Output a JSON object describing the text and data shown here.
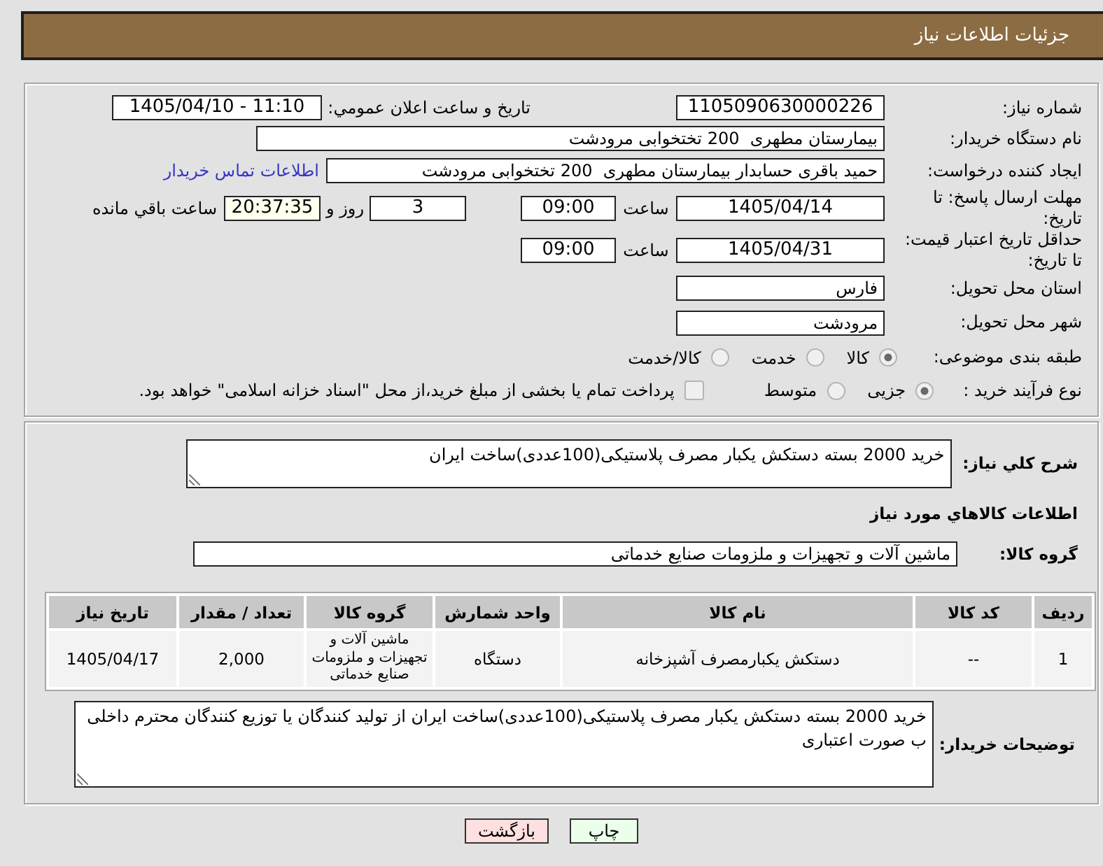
{
  "header": {
    "title": "جزئیات اطلاعات نیاز"
  },
  "need": {
    "need_number": {
      "label": "شماره نیاز:",
      "value": "1105090630000226"
    },
    "announcement": {
      "label": "تاريخ و ساعت اعلان عمومي:",
      "value": "1405/04/10 - 11:10"
    },
    "buyer_org": {
      "label": "نام دستگاه خریدار:",
      "value": "بیمارستان مطهری  200 تختخوابی مرودشت"
    },
    "requester": {
      "label": "ایجاد کننده درخواست:",
      "value": "حمید باقری حسابدار بیمارستان مطهری  200 تختخوابی مرودشت",
      "link": "اطلاعات تماس خریدار"
    },
    "response_deadline": {
      "label": "مهلت ارسال پاسخ: تا تاریخ:",
      "date": "1405/04/14",
      "time_label": "ساعت",
      "time": "09:00",
      "days": "3",
      "days_label": "روز و",
      "remaining": "20:37:35",
      "remaining_label": "ساعت باقي مانده"
    },
    "price_validity": {
      "label": "حداقل تاریخ اعتبار قیمت: تا تاریخ:",
      "date": "1405/04/31",
      "time_label": "ساعت",
      "time": "09:00"
    },
    "province": {
      "label": "استان محل تحویل:",
      "value": "فارس"
    },
    "city": {
      "label": "شهر محل تحویل:",
      "value": "مرودشت"
    },
    "category": {
      "label": "طبقه بندی موضوعی:",
      "options": [
        {
          "label": "کالا",
          "selected": true
        },
        {
          "label": "خدمت",
          "selected": false
        },
        {
          "label": "کالا/خدمت",
          "selected": false
        }
      ]
    },
    "purchase_process": {
      "label": "نوع فرآیند خرید :",
      "options": [
        {
          "label": "جزیی",
          "selected": true
        },
        {
          "label": "متوسط",
          "selected": false
        }
      ],
      "treasury": {
        "label": "پرداخت تمام یا بخشی از مبلغ خرید،از محل \"اسناد خزانه اسلامی\" خواهد بود.",
        "checked": false
      }
    }
  },
  "goods": {
    "description": {
      "label": "شرح کلي نياز:",
      "value": "خرید 2000 بسته دستکش یکبار مصرف پلاستیکی(100عددی)ساخت ایران"
    },
    "heading": "اطلاعات کالاهاي مورد نياز",
    "group": {
      "label": "گروه کالا:",
      "value": "ماشین آلات و تجهیزات و ملزومات صنایع خدماتی"
    },
    "table": {
      "columns": [
        "ردیف",
        "کد کالا",
        "نام کالا",
        "واحد شمارش",
        "گروه کالا",
        "تعداد / مقدار",
        "تاريخ نياز"
      ],
      "rows": [
        [
          "1",
          "--",
          "دستکش یکبارمصرف آشپزخانه",
          "دستگاه",
          "ماشین آلات و تجهیزات و ملزومات صنایع خدماتی",
          "2,000",
          "1405/04/17"
        ]
      ]
    },
    "buyer_notes": {
      "label": "توضیحات خریدار:",
      "value": "خرید 2000 بسته دستکش یکبار مصرف پلاستیکی(100عددی)ساخت ایران از تولید کنندگان یا توزیع کنندگان محترم داخلی ب صورت اعتباری"
    }
  },
  "buttons": [
    {
      "label": "چاپ",
      "kind": "print"
    },
    {
      "label": "بازگشت",
      "kind": "back"
    }
  ]
}
